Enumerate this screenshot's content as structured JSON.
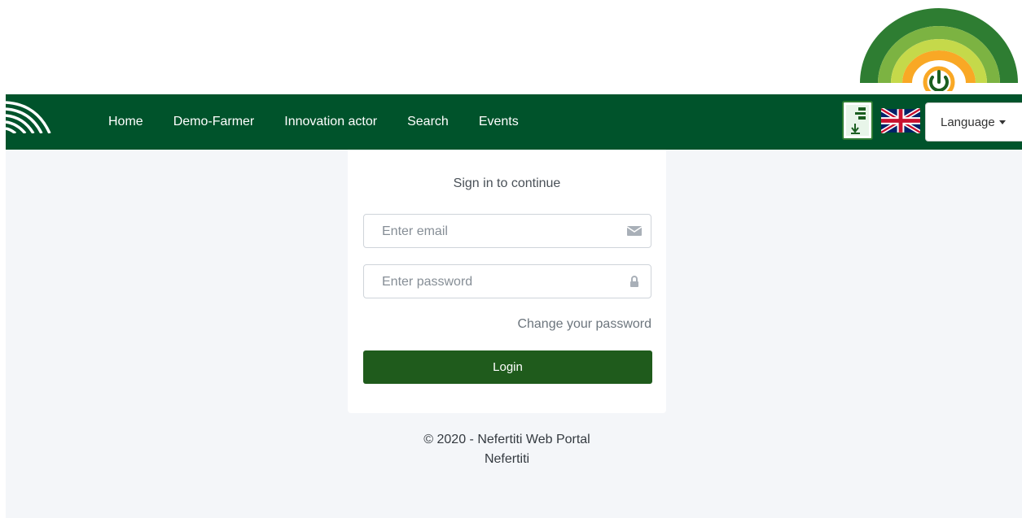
{
  "nav": {
    "links": [
      "Home",
      "Demo-Farmer",
      "Innovation actor",
      "Search",
      "Events"
    ],
    "language_label": "Language"
  },
  "icons": {
    "nav_logo": "signal-arcs-logo",
    "brand_logo": "rainbow-power-logo",
    "doc": "document-download-icon",
    "flag": "uk-flag-icon",
    "email": "envelope-icon",
    "password": "lock-icon",
    "caret": "caret-down-icon"
  },
  "colors": {
    "navbar": "#00532b",
    "login_button": "#1f5b1c",
    "page_background": "#f4f6f9"
  },
  "login": {
    "title": "Sign in to continue",
    "email_placeholder": "Enter email",
    "password_placeholder": "Enter password",
    "change_password": "Change your password",
    "button": "Login"
  },
  "footer": {
    "copyright": "© 2020 - Nefertiti Web Portal",
    "name": "Nefertiti"
  }
}
